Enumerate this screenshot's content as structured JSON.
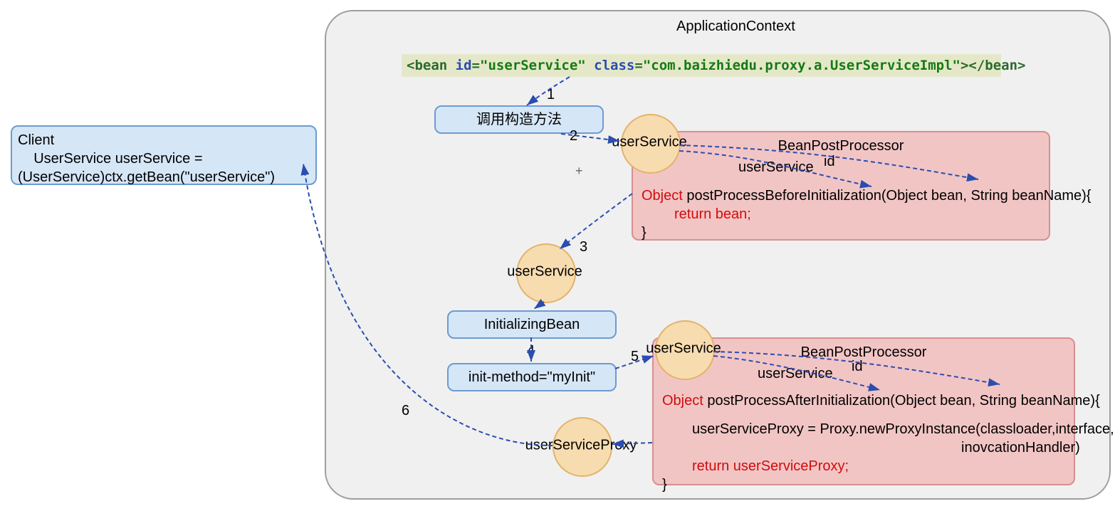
{
  "diagram": {
    "appContextTitle": "ApplicationContext",
    "beanTag": {
      "open1": "<bean",
      "idAttr": "id",
      "idVal": "\"userService\"",
      "classAttr": "class",
      "classVal": "\"com.baizhiedu.proxy.a.UserServiceImpl\"",
      "close1": "></",
      "close2": "bean",
      "close3": ">"
    },
    "client": {
      "line1": "Client",
      "line2": "    UserService userService =",
      "line3": "(UserService)ctx.getBean(\"userService\")"
    },
    "boxes": {
      "constructor": "调用构造方法",
      "initBean": "InitializingBean",
      "initMethod": "init-method=\"myInit\""
    },
    "circles": {
      "us1": "userService",
      "us2": "userService",
      "us3": "userService",
      "usProxy": "userServiceProxy"
    },
    "steps": {
      "s1": "1",
      "s2": "2",
      "s3": "3",
      "s4": "4",
      "s5": "5",
      "s6": "6"
    },
    "plus": "+",
    "panelTop": {
      "title": "BeanPostProcessor",
      "usLabel": "userService",
      "idLabel": "id",
      "sigPre": "Object",
      "sigPost": " postProcessBeforeInitialization(Object bean, String beanName){",
      "retPre": "return  bean;",
      "brace": "}"
    },
    "panelBottom": {
      "title": "BeanPostProcessor",
      "usLabel": "userService",
      "idLabel": "id",
      "sigPre": "Object",
      "sigPost": " postProcessAfterInitialization(Object bean, String beanName){",
      "body1": "userServiceProxy = Proxy.newProxyInstance(classloader,interface,",
      "body2": "inovcationHandler)",
      "retPre": "return  userServiceProxy;",
      "brace": "}"
    }
  }
}
